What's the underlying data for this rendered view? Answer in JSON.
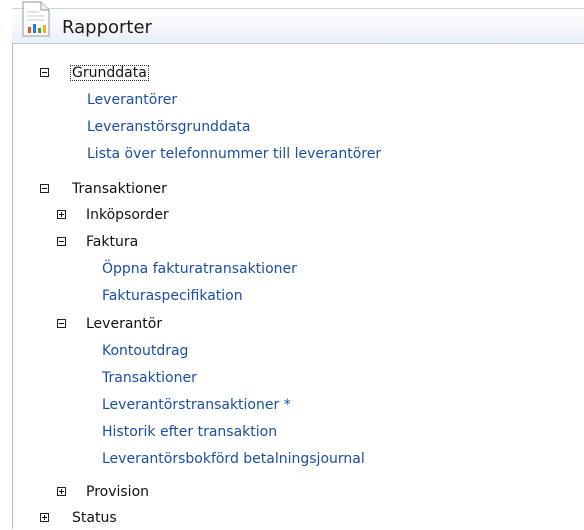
{
  "header": {
    "title": "Rapporter",
    "icon": "report-chart-icon"
  },
  "tree": {
    "grunddata": {
      "label": "Grunddata",
      "state": "expanded",
      "links": [
        "Leverantörer",
        "Leveranstörsgrunddata",
        "Lista över telefonnummer till leverantörer"
      ]
    },
    "transaktioner": {
      "label": "Transaktioner",
      "state": "expanded",
      "inkopsorder": {
        "label": "Inköpsorder",
        "state": "collapsed"
      },
      "faktura": {
        "label": "Faktura",
        "state": "expanded",
        "links": [
          "Öppna fakturatransaktioner",
          "Fakturaspecifikation"
        ]
      },
      "leverantor": {
        "label": "Leverantör",
        "state": "expanded",
        "links": [
          "Kontoutdrag",
          "Transaktioner",
          "Leverantörstransaktioner *",
          "Historik efter transaktion",
          "Leverantörsbokförd betalningsjournal"
        ]
      },
      "provision": {
        "label": "Provision",
        "state": "collapsed"
      }
    },
    "status": {
      "label": "Status",
      "state": "collapsed"
    }
  },
  "colors": {
    "link": "#1a4ea8",
    "text": "#111111",
    "header_border": "#b7c8e2"
  }
}
